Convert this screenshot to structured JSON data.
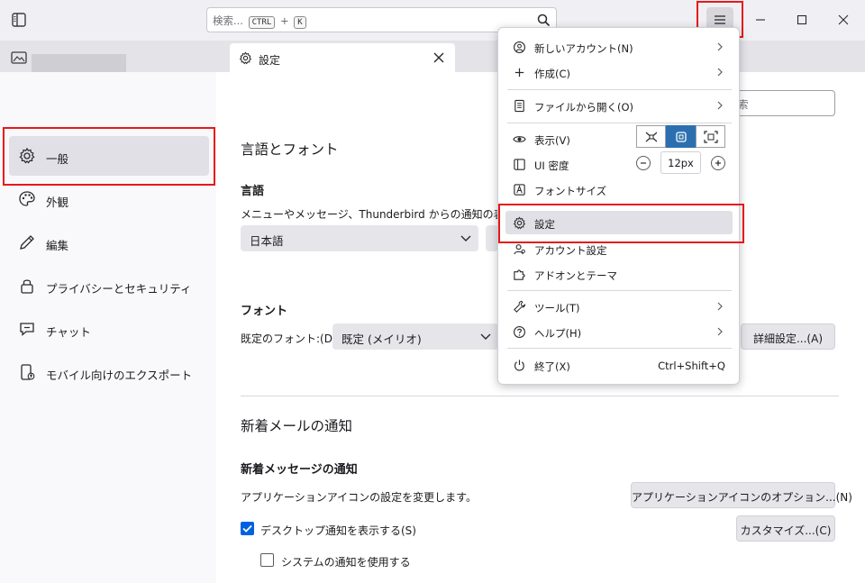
{
  "search": {
    "placeholder": "検索...",
    "key1": "CTRL",
    "plus": "+",
    "key2": "K"
  },
  "tab": {
    "title": "設定"
  },
  "nav": {
    "items": [
      {
        "label": "一般",
        "icon": "gear-icon"
      },
      {
        "label": "外観",
        "icon": "palette-icon"
      },
      {
        "label": "編集",
        "icon": "pencil-icon"
      },
      {
        "label": "プライバシーとセキュリティ",
        "icon": "lock-icon"
      },
      {
        "label": "チャット",
        "icon": "chat-icon"
      },
      {
        "label": "モバイル向けのエクスポート",
        "icon": "mobile-export-icon"
      }
    ]
  },
  "main": {
    "search_placeholder_partial": "索",
    "section_general": "言語とフォント",
    "language_heading": "言語",
    "language_desc": "メニューやメッセージ、Thunderbird からの通知の表示に",
    "language_value": "日本語",
    "font_heading": "フォント",
    "default_font_label": "既定のフォント:(D)",
    "default_font_value": "既定 (メイリオ)",
    "advanced_button": "詳細設定...(A)",
    "new_mail_section": "新着メールの通知",
    "new_message_heading": "新着メッセージの通知",
    "app_icon_desc": "アプリケーションアイコンの設定を変更します。",
    "app_icon_button": "アプリケーションアイコンのオプション...(N)",
    "desktop_notify_label": "デスクトップ通知を表示する(S)",
    "customize_button": "カスタマイズ...(C)",
    "system_notify_label": "システムの通知を使用する"
  },
  "menu": {
    "new_account": "新しいアカウント(N)",
    "create": "作成(C)",
    "open_file": "ファイルから開く(O)",
    "view": "表示(V)",
    "ui_density": "UI 密度",
    "font_size": "フォントサイズ",
    "font_size_value": "12px",
    "settings": "設定",
    "account_settings": "アカウント設定",
    "addons": "アドオンとテーマ",
    "tools": "ツール(T)",
    "help": "ヘルプ(H)",
    "quit": "終了(X)",
    "quit_shortcut": "Ctrl+Shift+Q"
  }
}
